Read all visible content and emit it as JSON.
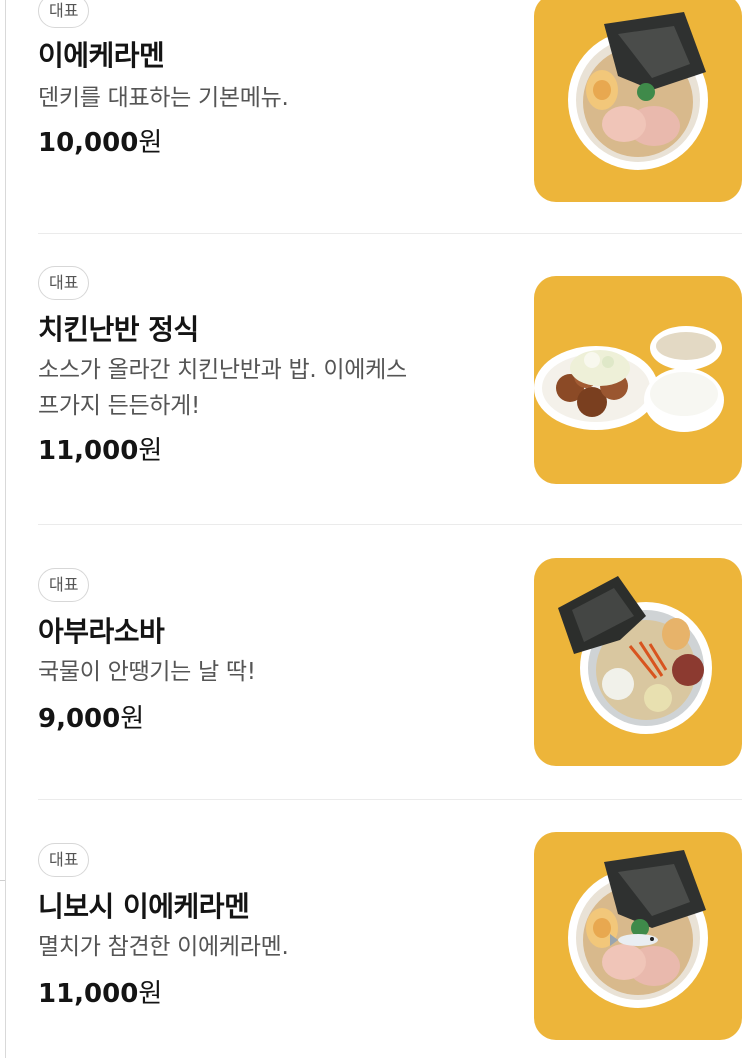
{
  "menu": {
    "items": [
      {
        "badge": "대표",
        "name": "이에케라멘",
        "desc_lines": [
          "덴키를 대표하는 기본메뉴."
        ],
        "price_number": "10,000",
        "price_unit": "원",
        "image_icon": "ramen-bowl-photo"
      },
      {
        "badge": "대표",
        "name": "치킨난반 정식",
        "desc_lines": [
          "소스가 올라간 치킨난반과 밥. 이에케스",
          "프가지 든든하게!"
        ],
        "price_number": "11,000",
        "price_unit": "원",
        "image_icon": "chicken-nanban-set-photo"
      },
      {
        "badge": "대표",
        "name": "아부라소바",
        "desc_lines": [
          "국물이 안땡기는 날 딱!"
        ],
        "price_number": "9,000",
        "price_unit": "원",
        "image_icon": "abura-soba-bowl-photo"
      },
      {
        "badge": "대표",
        "name": "니보시 이에케라멘",
        "desc_lines": [
          "멸치가 참견한 이에케라멘."
        ],
        "price_number": "11,000",
        "price_unit": "원",
        "image_icon": "niboshi-ramen-bowl-photo"
      }
    ]
  },
  "colors": {
    "thumbnail_background": "#edb53a",
    "badge_border": "#d7d7d7",
    "divider": "#ebebeb"
  }
}
